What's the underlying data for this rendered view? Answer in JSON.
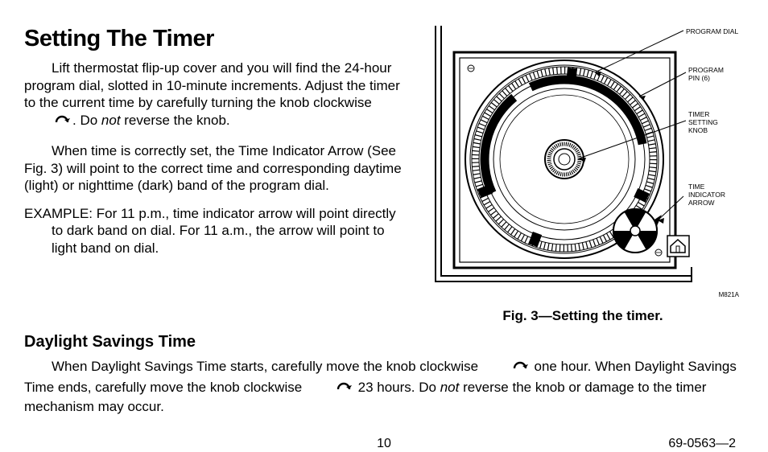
{
  "heading": "Setting The Timer",
  "para1a": "Lift thermostat flip-up cover and you will find the 24-hour program dial, slotted in 10-minute increments. Adjust the timer to the current time by carefully turning the knob clockwise",
  "para1b": ". Do ",
  "not_word": "not",
  "para1c": " reverse the knob.",
  "para2": "When time is correctly set, the Time Indicator Arrow (See Fig. 3) will point to the correct time and corresponding daytime (light) or nighttime (dark) band of the program dial.",
  "example": "EXAMPLE: For 11 p.m., time indicator arrow will point directly to dark band on dial. For 11 a.m., the arrow will point to light band on dial.",
  "dst_heading": "Daylight Savings Time",
  "dst_a": "When Daylight Savings Time starts, carefully move the knob clockwise",
  "dst_b": " one hour. When Daylight Savings Time ends, carefully move the knob clockwise",
  "dst_c": " 23 hours. Do ",
  "dst_d": " reverse the knob or damage to the timer mechanism may occur.",
  "figure": {
    "caption": "Fig. 3—Setting the timer.",
    "labels": {
      "program_dial": "PROGRAM DIAL",
      "program_pin_1": "PROGRAM",
      "program_pin_2": "PIN (6)",
      "timer_knob_1": "TIMER",
      "timer_knob_2": "SETTING",
      "timer_knob_3": "KNOB",
      "time_arrow_1": "TIME",
      "time_arrow_2": "INDICATOR",
      "time_arrow_3": "ARROW"
    },
    "model_code": "M821A"
  },
  "footer": {
    "page": "10",
    "doc_number": "69-0563—2"
  }
}
